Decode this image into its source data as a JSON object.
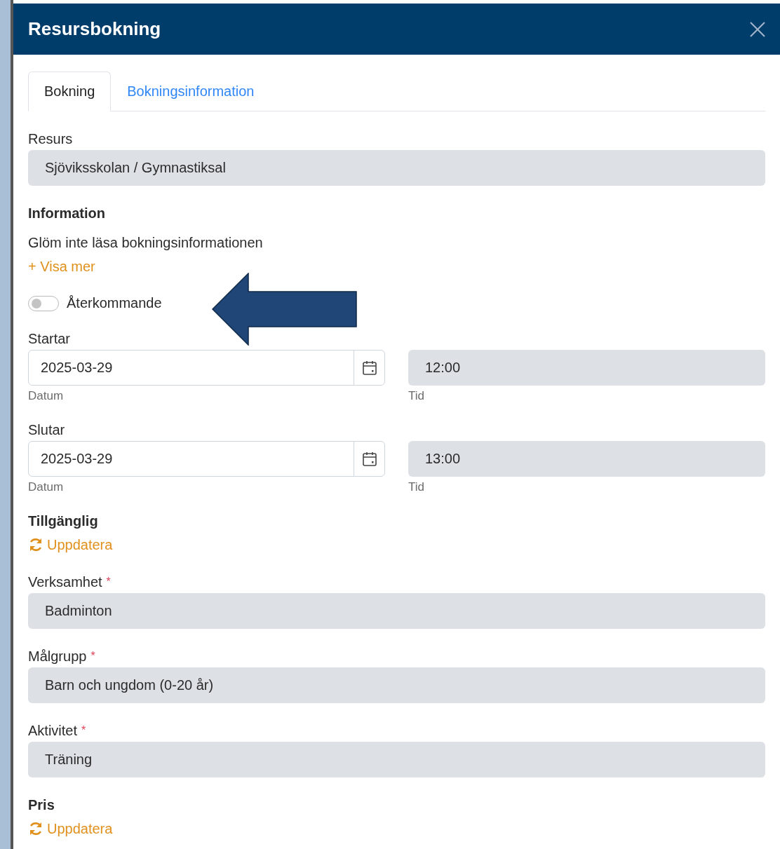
{
  "dialog": {
    "title": "Resursbokning"
  },
  "tabs": [
    {
      "label": "Bokning",
      "selected": true
    },
    {
      "label": "Bokningsinformation",
      "selected": false
    }
  ],
  "sections": [
    {
      "kind": "readonly",
      "label": "Resurs",
      "value": "Sjöviksskolan / Gymnastiksal"
    },
    {
      "kind": "info",
      "heading": "Information",
      "text": "Glöm inte läsa bokningsinformationen",
      "link": "+ Visa mer"
    },
    {
      "kind": "toggle",
      "label": "Återkommande",
      "on": false
    },
    {
      "kind": "datetime",
      "label": "Startar",
      "date": "2025-03-29",
      "date_hint": "Datum",
      "time": "12:00",
      "time_hint": "Tid"
    },
    {
      "kind": "datetime",
      "label": "Slutar",
      "date": "2025-03-29",
      "date_hint": "Datum",
      "time": "13:00",
      "time_hint": "Tid"
    },
    {
      "kind": "refresh",
      "heading": "Tillgänglig",
      "link": "Uppdatera"
    },
    {
      "kind": "readonly",
      "label": "Verksamhet",
      "required_mark": "*",
      "value": "Badminton"
    },
    {
      "kind": "readonly",
      "label": "Målgrupp",
      "required_mark": "*",
      "value": "Barn och ungdom (0-20 år)"
    },
    {
      "kind": "readonly",
      "label": "Aktivitet",
      "required_mark": "*",
      "value": "Träning"
    },
    {
      "kind": "refresh",
      "heading": "Pris",
      "link": "Uppdatera"
    }
  ]
}
